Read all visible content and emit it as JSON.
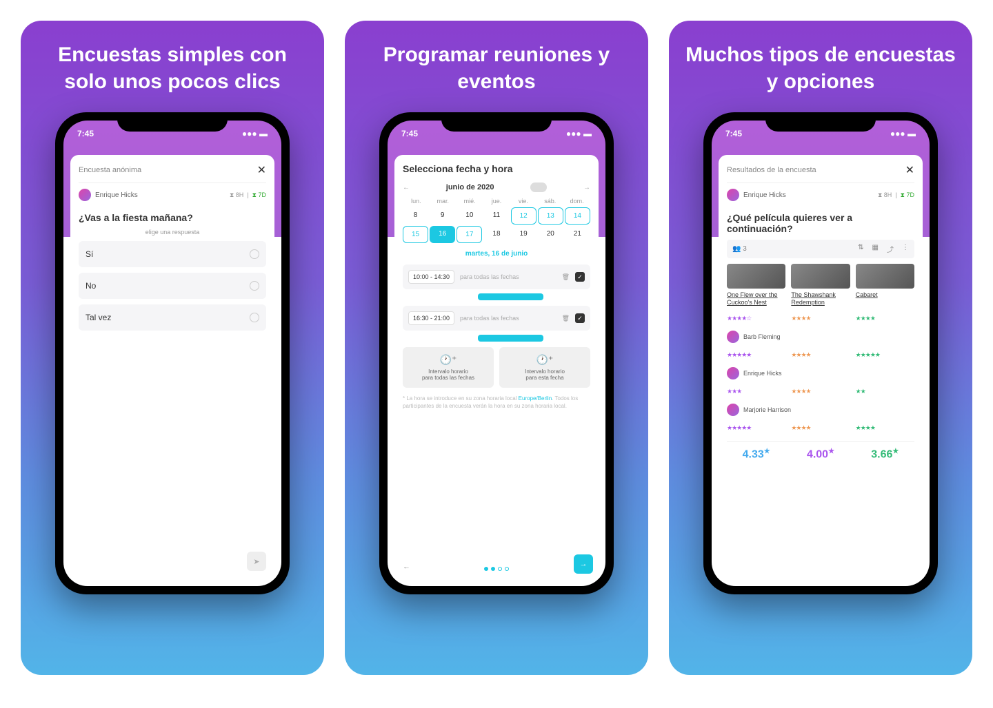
{
  "cards": [
    {
      "title": "Encuestas simples con solo unos pocos clics"
    },
    {
      "title": "Programar reuniones y eventos"
    },
    {
      "title": "Muchos tipos de encuestas y opciones"
    }
  ],
  "status_time": "7:45",
  "poll1": {
    "header": "Encuesta anónima",
    "user": "Enrique Hicks",
    "badge1": "8H",
    "badge2": "7D",
    "question": "¿Vas a la fiesta mañana?",
    "hint": "elige una respuesta",
    "options": [
      "Sí",
      "No",
      "Tal vez"
    ]
  },
  "calendar": {
    "title": "Selecciona fecha y hora",
    "month": "junio de 2020",
    "dow": [
      "lun.",
      "mar.",
      "mié.",
      "jue.",
      "vie.",
      "sáb.",
      "dom."
    ],
    "week1": [
      "8",
      "9",
      "10",
      "11",
      "12",
      "13",
      "14"
    ],
    "week2": [
      "15",
      "16",
      "17",
      "18",
      "19",
      "20",
      "21"
    ],
    "selected_date": "martes, 16 de junio",
    "slot1": "10:00 - 14:30",
    "slot2": "16:30 - 21:00",
    "slot_label": "para todas las fechas",
    "btn1_l1": "Intervalo horario",
    "btn1_l2": "para todas las fechas",
    "btn2_l1": "Intervalo horario",
    "btn2_l2": "para esta fecha",
    "footnote_pre": "* La hora se introduce en su zona horaria local ",
    "footnote_link": "Europe/Berlin",
    "footnote_post": ". Todos los participantes de la encuesta verán la hora en su zona horaria local."
  },
  "results": {
    "header": "Resultados de la encuesta",
    "user": "Enrique Hicks",
    "badge1": "8H",
    "badge2": "7D",
    "question": "¿Qué película quieres ver a continuación?",
    "count": "3",
    "movies": [
      "One Flew over the Cuckoo's Nest",
      "The Shawshank Redemption",
      "Cabaret"
    ],
    "voters": [
      "Barb Fleming",
      "Enrique Hicks",
      "Marjorie Harrison"
    ],
    "scores": [
      "4.33",
      "4.00",
      "3.66"
    ]
  }
}
